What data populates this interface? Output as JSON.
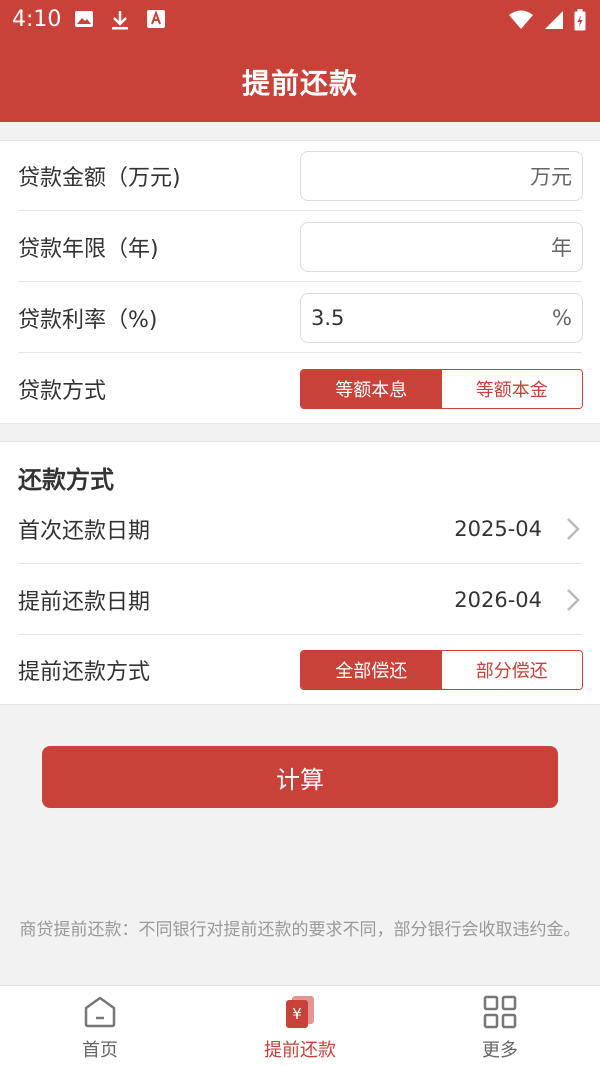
{
  "status_bar": {
    "time": "4:10",
    "left_icons": [
      "image-icon",
      "download-icon",
      "text-a-icon"
    ],
    "right_icons": [
      "wifi-icon",
      "signal-icon",
      "battery-icon"
    ]
  },
  "app_bar": {
    "title": "提前还款"
  },
  "loan_section": {
    "amount": {
      "label": "贷款金额（万元)",
      "value": "",
      "unit": "万元"
    },
    "term": {
      "label": "贷款年限（年)",
      "value": "",
      "unit": "年"
    },
    "rate": {
      "label": "贷款利率（%)",
      "value": "3.5",
      "unit": "%"
    },
    "method": {
      "label": "贷款方式",
      "options": [
        "等额本息",
        "等额本金"
      ],
      "selected": "等额本息"
    }
  },
  "repay_section": {
    "title": "还款方式",
    "first_date": {
      "label": "首次还款日期",
      "value": "2025-04"
    },
    "prepay_date": {
      "label": "提前还款日期",
      "value": "2026-04"
    },
    "prepay_method": {
      "label": "提前还款方式",
      "options": [
        "全部偿还",
        "部分偿还"
      ],
      "selected": "全部偿还"
    }
  },
  "calculate_label": "计算",
  "notice": "商贷提前还款：不同银行对提前还款的要求不同，部分银行会收取违约金。",
  "bottom_nav": [
    {
      "label": "首页",
      "icon": "home-icon",
      "active": false
    },
    {
      "label": "提前还款",
      "icon": "prepay-icon",
      "active": true
    },
    {
      "label": "更多",
      "icon": "grid-icon",
      "active": false
    }
  ],
  "colors": {
    "primary": "#c8423a",
    "background": "#f2f2f2",
    "text": "#333333",
    "muted": "#999999"
  }
}
